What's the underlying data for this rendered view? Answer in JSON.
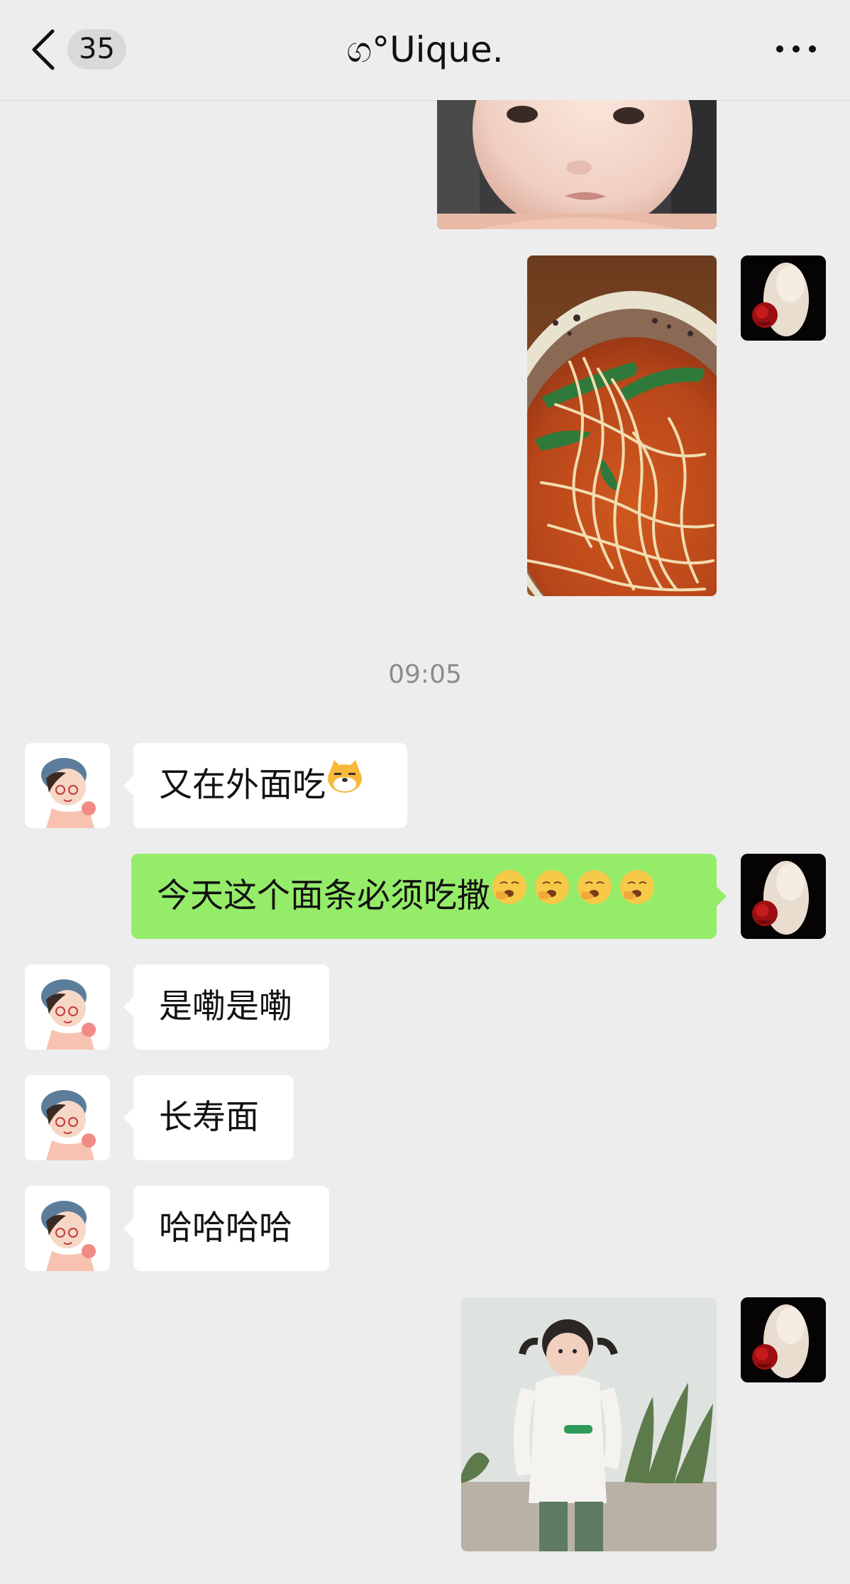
{
  "header": {
    "back_label": "<",
    "unread_count": "35",
    "title": "ග°Uique.",
    "more_label": "more options"
  },
  "colors": {
    "background": "#ededed",
    "bubble_incoming": "#ffffff",
    "bubble_outgoing": "#95ec69",
    "timestamp": "#8c8c8c"
  },
  "messages": {
    "timestamp": "09:05",
    "m1": "又在外面吃",
    "m2": "今天这个面条必须吃撒",
    "m3": "是嘞是嘞",
    "m4": "长寿面",
    "m5": "哈哈哈哈"
  },
  "icons": {
    "m1_emoji": "dog-face-emoji",
    "m2_emoji": "yawning-face-emoji",
    "back": "chevron-left-icon",
    "more": "ellipsis-icon"
  }
}
